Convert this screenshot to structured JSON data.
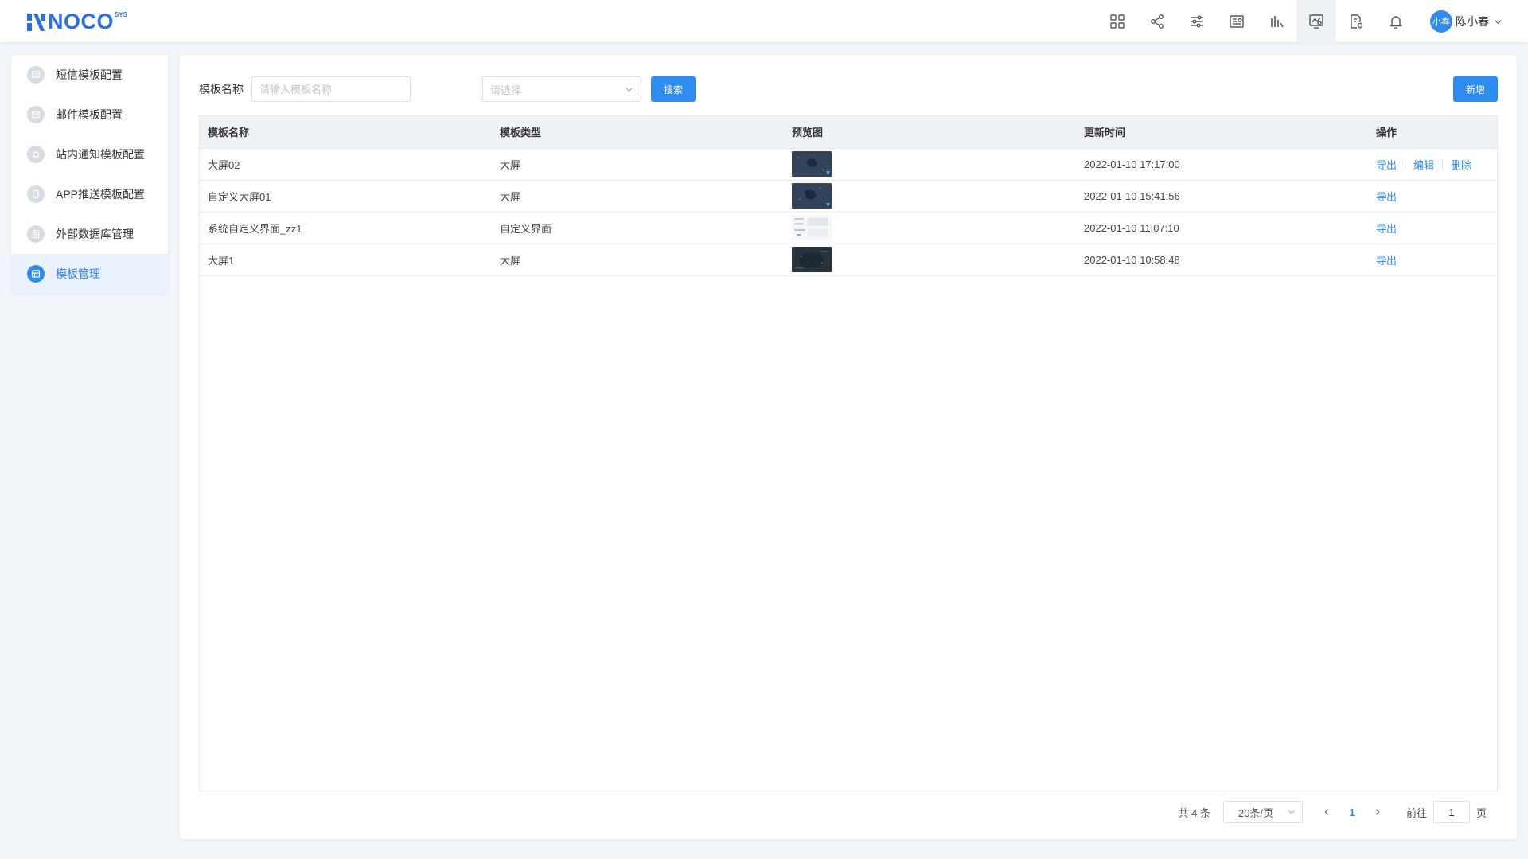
{
  "header": {
    "logo_text": "NOCO",
    "logo_sup": "SYS",
    "icons": [
      "apps-icon",
      "share-icon",
      "sliders-icon",
      "report-icon",
      "chart-bars-icon",
      "screen-chart-icon",
      "doc-settings-icon",
      "bell-icon"
    ],
    "active_icon": "screen-chart-icon",
    "user": {
      "avatar_text": "小春",
      "name": "陈小春"
    }
  },
  "sidebar": {
    "items": [
      {
        "label": "短信模板配置",
        "icon": "message-icon"
      },
      {
        "label": "邮件模板配置",
        "icon": "mail-icon"
      },
      {
        "label": "站内通知模板配置",
        "icon": "bell-icon"
      },
      {
        "label": "APP推送模板配置",
        "icon": "phone-icon"
      },
      {
        "label": "外部数据库管理",
        "icon": "database-icon"
      },
      {
        "label": "模板管理",
        "icon": "template-icon",
        "active": true
      }
    ]
  },
  "filter": {
    "name_label": "模板名称",
    "name_placeholder": "请输入模板名称",
    "type_placeholder": "请选择",
    "search_label": "搜索",
    "add_label": "新增"
  },
  "table": {
    "columns": [
      "模板名称",
      "模板类型",
      "预览图",
      "更新时间",
      "操作"
    ],
    "rows": [
      {
        "name": "大屏02",
        "type": "大屏",
        "thumb": "dark-map",
        "updated": "2022-01-10 17:17:00",
        "ops": [
          "导出",
          "编辑",
          "删除"
        ]
      },
      {
        "name": "自定义大屏01",
        "type": "大屏",
        "thumb": "dark-map",
        "updated": "2022-01-10 15:41:56",
        "ops": [
          "导出"
        ]
      },
      {
        "name": "系统自定义界面_zz1",
        "type": "自定义界面",
        "thumb": "light-form",
        "updated": "2022-01-10 11:07:10",
        "ops": [
          "导出"
        ]
      },
      {
        "name": "大屏1",
        "type": "大屏",
        "thumb": "dark-globe",
        "updated": "2022-01-10 10:58:48",
        "ops": [
          "导出"
        ]
      }
    ]
  },
  "pagination": {
    "total_text": "共 4 条",
    "page_size": "20条/页",
    "current_page": "1",
    "goto_label": "前往",
    "goto_value": "1",
    "page_suffix": "页"
  },
  "colors": {
    "primary": "#2e8cf0",
    "active_bg": "#e8f1fd",
    "page_bg": "#f2f5f9"
  }
}
